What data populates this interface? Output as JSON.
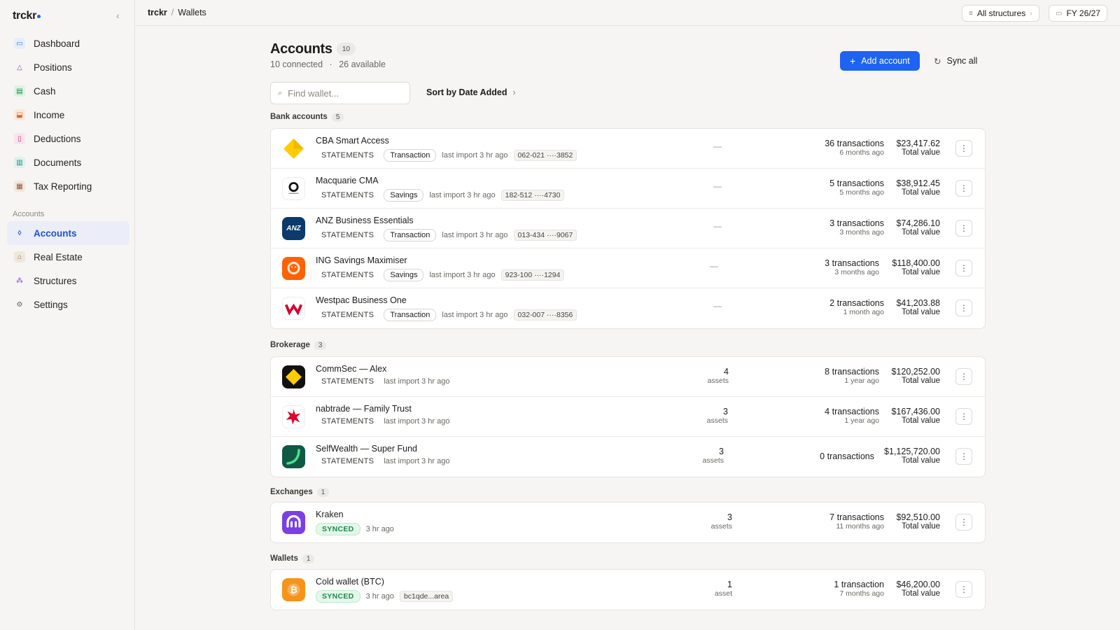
{
  "app": {
    "brand": "trckr"
  },
  "sidebar": {
    "collapse_glyph": "‹",
    "nav": [
      {
        "label": "Dashboard",
        "icon": "dashboard-icon"
      },
      {
        "label": "Positions",
        "icon": "positions-icon"
      },
      {
        "label": "Cash",
        "icon": "cash-icon"
      },
      {
        "label": "Income",
        "icon": "income-icon"
      },
      {
        "label": "Deductions",
        "icon": "deductions-icon"
      },
      {
        "label": "Documents",
        "icon": "documents-icon"
      },
      {
        "label": "Tax Reporting",
        "icon": "tax-reporting-icon"
      }
    ],
    "section_label": "Accounts",
    "accounts_nav": [
      {
        "label": "Accounts",
        "icon": "accounts-icon",
        "active": true
      },
      {
        "label": "Real Estate",
        "icon": "real-estate-icon"
      },
      {
        "label": "Structures",
        "icon": "structures-icon"
      },
      {
        "label": "Settings",
        "icon": "settings-icon"
      }
    ]
  },
  "topbar": {
    "breadcrumb_root": "trckr",
    "breadcrumb_sep": "/",
    "breadcrumb_current": "Wallets",
    "structures_label": "All structures",
    "fy_label": "FY 26/27"
  },
  "header": {
    "title": "Accounts",
    "count": "10",
    "connected": "10 connected",
    "separator": "·",
    "available": "26 available",
    "add_label": "Add account",
    "sync_label": "Sync all"
  },
  "search": {
    "placeholder": "Find wallet..."
  },
  "sort": {
    "label": "Sort by Date Added"
  },
  "sections": [
    {
      "label": "Bank accounts",
      "count": "5",
      "rows": [
        {
          "name": "CBA Smart Access",
          "stmt": "STATEMENTS",
          "tag": "Transaction",
          "last_import": "last import 3 hr ago",
          "acct": "062-021 ····3852",
          "dash": "—",
          "tx": "36 transactions",
          "ago": "6 months ago",
          "amount": "$23,417.62",
          "value_label": "Total value",
          "logo": "cba"
        },
        {
          "name": "Macquarie CMA",
          "stmt": "STATEMENTS",
          "tag": "Savings",
          "last_import": "last import 3 hr ago",
          "acct": "182-512 ····4730",
          "dash": "—",
          "tx": "5 transactions",
          "ago": "5 months ago",
          "amount": "$38,912.45",
          "value_label": "Total value",
          "logo": "macquarie"
        },
        {
          "name": "ANZ Business Essentials",
          "stmt": "STATEMENTS",
          "tag": "Transaction",
          "last_import": "last import 3 hr ago",
          "acct": "013-434 ····9067",
          "dash": "—",
          "tx": "3 transactions",
          "ago": "3 months ago",
          "amount": "$74,286.10",
          "value_label": "Total value",
          "logo": "anz"
        },
        {
          "name": "ING Savings Maximiser",
          "stmt": "STATEMENTS",
          "tag": "Savings",
          "last_import": "last import 3 hr ago",
          "acct": "923-100 ····1294",
          "dash": "—",
          "tx": "3 transactions",
          "ago": "3 months ago",
          "amount": "$118,400.00",
          "value_label": "Total value",
          "logo": "ing"
        },
        {
          "name": "Westpac Business One",
          "stmt": "STATEMENTS",
          "tag": "Transaction",
          "last_import": "last import 3 hr ago",
          "acct": "032-007 ····8356",
          "dash": "—",
          "tx": "2 transactions",
          "ago": "1 month ago",
          "amount": "$41,203.88",
          "value_label": "Total value",
          "logo": "westpac"
        }
      ]
    },
    {
      "label": "Brokerage",
      "count": "3",
      "rows": [
        {
          "name": "CommSec — Alex",
          "stmt": "STATEMENTS",
          "last_import": "last import 3 hr ago",
          "assets": "4",
          "assets_label": "assets",
          "tx": "8 transactions",
          "ago": "1 year ago",
          "amount": "$120,252.00",
          "value_label": "Total value",
          "logo": "commsec"
        },
        {
          "name": "nabtrade — Family Trust",
          "stmt": "STATEMENTS",
          "last_import": "last import 3 hr ago",
          "assets": "3",
          "assets_label": "assets",
          "tx": "4 transactions",
          "ago": "1 year ago",
          "amount": "$167,436.00",
          "value_label": "Total value",
          "logo": "nab"
        },
        {
          "name": "SelfWealth — Super Fund",
          "stmt": "STATEMENTS",
          "last_import": "last import 3 hr ago",
          "assets": "3",
          "assets_label": "assets",
          "tx": "0 transactions",
          "ago": "",
          "amount": "$1,125,720.00",
          "value_label": "Total value",
          "logo": "selfwealth"
        }
      ]
    },
    {
      "label": "Exchanges",
      "count": "1",
      "rows": [
        {
          "name": "Kraken",
          "synced": "SYNCED",
          "last_import": "3 hr ago",
          "assets": "3",
          "assets_label": "assets",
          "tx": "7 transactions",
          "ago": "11 months ago",
          "amount": "$92,510.00",
          "value_label": "Total value",
          "logo": "kraken"
        }
      ]
    },
    {
      "label": "Wallets",
      "count": "1",
      "rows": [
        {
          "name": "Cold wallet (BTC)",
          "synced": "SYNCED",
          "last_import": "3 hr ago",
          "acct": "bc1qde...area",
          "assets": "1",
          "assets_label": "asset",
          "tx": "1 transaction",
          "ago": "7 months ago",
          "amount": "$46,200.00",
          "value_label": "Total value",
          "logo": "btc"
        }
      ]
    }
  ],
  "colors": {
    "accent": "#1e63f2",
    "synced_bg": "#e3f7ea",
    "synced_text": "#1c8a49"
  }
}
